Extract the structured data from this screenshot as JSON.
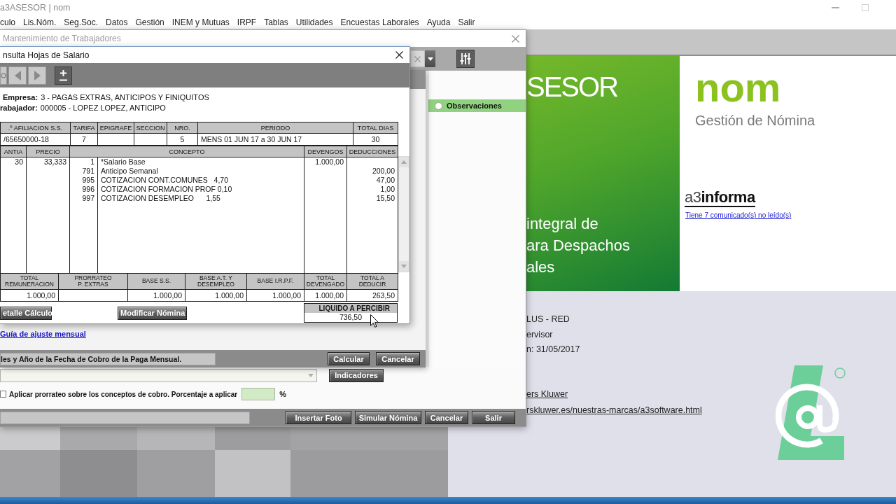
{
  "app": {
    "title": "a3ASESOR | nom",
    "menu": [
      "culo",
      "Lis.Nóm.",
      "Seg.Soc.",
      "Datos",
      "Gestión",
      "INEM y Mutuas",
      "IRPF",
      "Tablas",
      "Utilidades",
      "Encuestas Laborales",
      "Ayuda",
      "Salir"
    ]
  },
  "splash": {
    "brand": "SESOR",
    "tagline": [
      "integral de",
      "ara Despachos",
      "ales"
    ],
    "product": "nom",
    "subtitle": "Gestión de Nómina",
    "news_logo": "a3**informa**",
    "news_link": "Tiene 7 comunicado(s) no leído(s)"
  },
  "info": {
    "lines": [
      "LUS - RED",
      "ervisor",
      "n: 31/05/2017"
    ],
    "links": [
      "ers Kluwer",
      "rskluwer.es/nuestras-marcas/a3software.html"
    ]
  },
  "maintenance_window": {
    "title": "Mantenimiento de Trabajadores",
    "side_items": [
      {
        "label": "Observaciones",
        "checked": false
      }
    ],
    "indicators_button": "Indicadores",
    "prorate": {
      "label": "Aplicar prorrateo sobre los conceptos de cobro. Porcentaje a aplicar",
      "checked": false,
      "unit": "%"
    },
    "buttons": [
      "Insertar Foto",
      "Simular Nómina",
      "Cancelar",
      "Salir"
    ]
  },
  "calc_dialog": {
    "link": "Guía de ajuste mensual",
    "message": "les y Año de la Fecha de Cobro de la Paga Mensual.",
    "buttons": [
      "Calcular",
      "Cancelar"
    ]
  },
  "salary_window": {
    "title": "nsulta Hojas de Salario",
    "header": [
      {
        "label": "Empresa:",
        "value": "3 - PAGAS EXTRAS, ANTICIPOS Y FINIQUITOS"
      },
      {
        "label": "rabajador:",
        "value": "000005 - LOPEZ LOPEZ, ANTICIPO"
      }
    ],
    "id_table": [
      {
        "label": ".º AFILIACION S.S.",
        "value": "/65650000-18"
      },
      {
        "label": "TARIFA",
        "value": "7"
      },
      {
        "label": "EPIGRAFE"
      },
      {
        "label": "SECCION"
      },
      {
        "label": "NRO.",
        "value": "5"
      },
      {
        "label": "PERIODO",
        "value": "MENS 01 JUN 17 a 30 JUN 17"
      },
      {
        "label": "TOTAL DIAS",
        "value": "30"
      }
    ],
    "concepts": {
      "columns": [
        "ANTIA",
        "PRECIO",
        "CONCEPTO",
        "DEVENGOS",
        "DEDUCCIONES"
      ],
      "rows": [
        {
          "quantity": "30",
          "price": "33,333",
          "code": "1",
          "concept": "*Salario Base",
          "earning": "1.000,00"
        },
        {
          "code": "791",
          "concept": "Anticipo Semanal",
          "deduction": "200,00"
        },
        {
          "code": "995",
          "concept": "COTIZACION CONT.COMUNES   4,70",
          "deduction": "47,00"
        },
        {
          "code": "996",
          "concept": "COTIZACION FORMACION PROF 0,10",
          "deduction": "1,00"
        },
        {
          "code": "997",
          "concept": "COTIZACION DESEMPLEO      1,55",
          "deduction": "15,50"
        }
      ]
    },
    "totals": [
      {
        "label": "TOTAL\nREMUNERACION",
        "value": "1.000,00"
      },
      {
        "label": "PRORRATEO\nP. EXTRAS"
      },
      {
        "label": "BASE S.S.",
        "value": "1.000,00"
      },
      {
        "label": "BASE A.T. Y\nDESEMPLEO",
        "value": "1.000,00"
      },
      {
        "label": "BASE I.R.P.F.",
        "value": "1.000,00"
      },
      {
        "label": "TOTAL\nDEVENGADO",
        "value": "1.000,00"
      },
      {
        "label": "TOTAL A\nDEDUCIR",
        "value": "263,50"
      }
    ],
    "buttons": [
      "etalle Cálculo",
      "Modificar Nómina"
    ],
    "net_pay": {
      "label": "LIQUIDO A PERCIBIR",
      "value": "736,50"
    }
  }
}
